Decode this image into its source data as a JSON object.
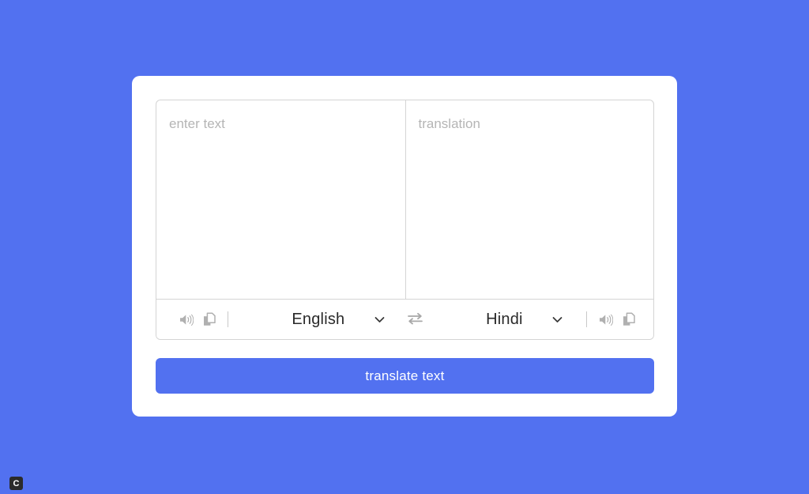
{
  "theme": {
    "background_color": "#5271f0",
    "card_color": "#ffffff",
    "accent_color": "#5271f0",
    "border_color": "#d4d4d4",
    "placeholder_color": "#b5b5b5",
    "text_color": "#2a2a2a"
  },
  "source_pane": {
    "placeholder": "enter text",
    "value": ""
  },
  "target_pane": {
    "placeholder": "translation",
    "value": ""
  },
  "toolbar": {
    "source_speak_icon": "speaker-icon",
    "source_copy_icon": "copy-icon",
    "source_language": "English",
    "source_chevron_icon": "chevron-down-icon",
    "swap_icon": "swap-arrows-icon",
    "target_language": "Hindi",
    "target_chevron_icon": "chevron-down-icon",
    "target_speak_icon": "speaker-icon",
    "target_copy_icon": "copy-icon"
  },
  "actions": {
    "translate_label": "translate text"
  },
  "badge": {
    "label": "C"
  }
}
